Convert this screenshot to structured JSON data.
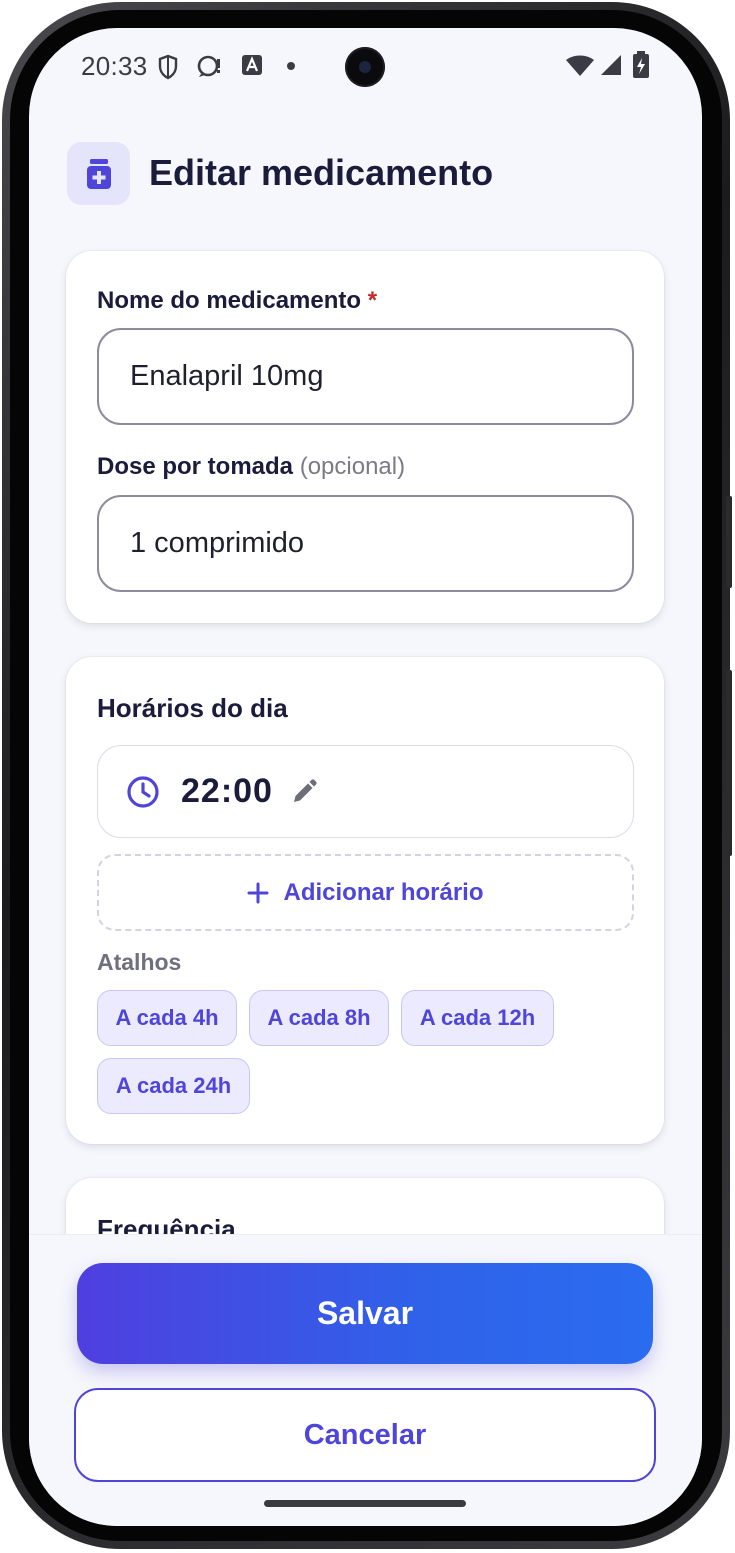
{
  "status_bar": {
    "time": "20:33",
    "icons": [
      "shield-icon",
      "chat-alert-icon",
      "font-a-icon",
      "dot-icon",
      "wifi-icon",
      "signal-icon",
      "battery-charging-icon"
    ]
  },
  "header": {
    "icon": "medicine-bottle-icon",
    "title": "Editar medicamento"
  },
  "medication": {
    "name_label": "Nome do medicamento",
    "required_mark": "*",
    "name_value": "Enalapril 10mg",
    "dose_label": "Dose por tomada",
    "dose_optional": "(opcional)",
    "dose_value": "1 comprimido"
  },
  "schedule": {
    "title": "Horários do dia",
    "times": [
      {
        "value": "22:00",
        "icon": "clock-icon",
        "edit_icon": "pencil-icon"
      }
    ],
    "add_label": "Adicionar horário",
    "shortcuts_label": "Atalhos",
    "shortcuts": [
      "A cada 4h",
      "A cada 8h",
      "A cada 12h",
      "A cada 24h"
    ]
  },
  "frequency": {
    "title": "Frequência"
  },
  "actions": {
    "save_label": "Salvar",
    "cancel_label": "Cancelar"
  },
  "colors": {
    "accent": "#4f46d9",
    "gradient_start": "#4f3fe0",
    "gradient_end": "#2a6cef",
    "required": "#c62828",
    "background": "#f6f7fc"
  }
}
